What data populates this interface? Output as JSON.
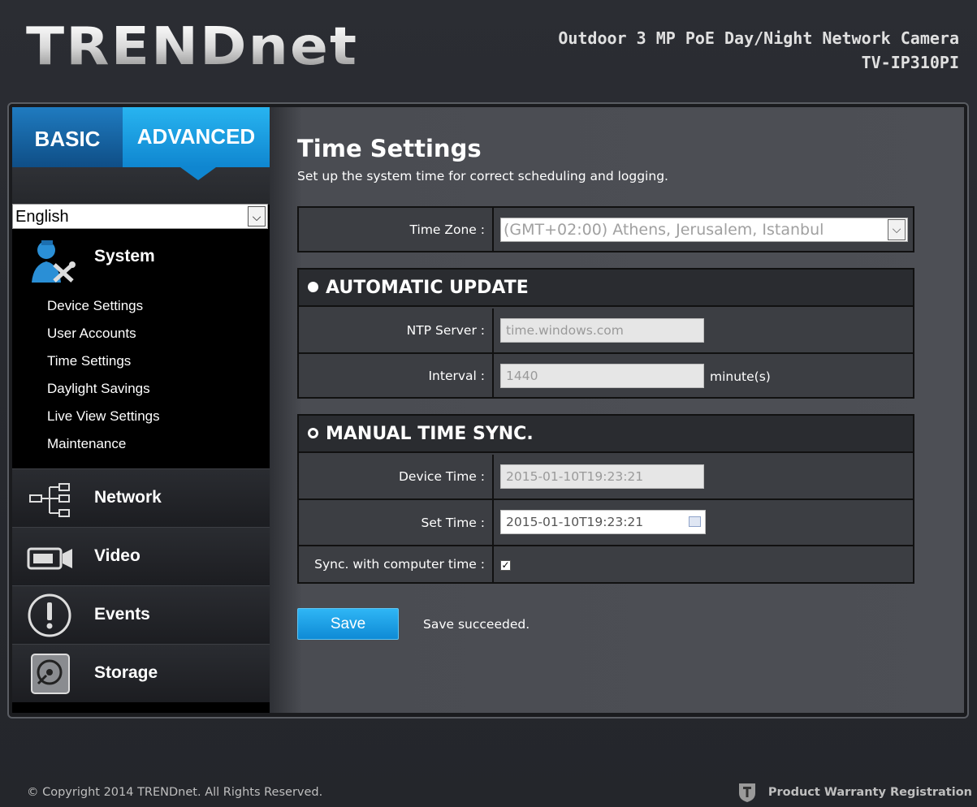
{
  "header": {
    "logo_text": "TRENDnet",
    "product_line": "Outdoor 3 MP PoE Day/Night Network Camera",
    "model": "TV-IP310PI"
  },
  "tabs": {
    "basic": "BASIC",
    "advanced": "ADVANCED",
    "active": "ADVANCED"
  },
  "language": {
    "selected": "English"
  },
  "sidebar": {
    "system": {
      "label": "System",
      "icon": "user-tools-icon",
      "items": [
        {
          "label": "Device Settings"
        },
        {
          "label": "User Accounts"
        },
        {
          "label": "Time Settings"
        },
        {
          "label": "Daylight Savings"
        },
        {
          "label": "Live View Settings"
        },
        {
          "label": "Maintenance"
        }
      ]
    },
    "sections": [
      {
        "label": "Network",
        "icon": "network-tree-icon"
      },
      {
        "label": "Video",
        "icon": "camera-icon"
      },
      {
        "label": "Events",
        "icon": "alert-icon"
      },
      {
        "label": "Storage",
        "icon": "disk-icon"
      }
    ]
  },
  "page": {
    "title": "Time Settings",
    "subtitle": "Set up the system time for correct scheduling and logging."
  },
  "timezone": {
    "label": "Time Zone :",
    "value": "(GMT+02:00) Athens, Jerusalem, Istanbul"
  },
  "automatic": {
    "heading": "AUTOMATIC UPDATE",
    "ntp_label": "NTP Server :",
    "ntp_value": "time.windows.com",
    "interval_label": "Interval :",
    "interval_value": "1440",
    "interval_unit": "minute(s)"
  },
  "manual": {
    "heading": "MANUAL TIME SYNC.",
    "device_time_label": "Device Time :",
    "device_time_value": "2015-01-10T19:23:21",
    "set_time_label": "Set Time :",
    "set_time_value": "2015-01-10T19:23:21",
    "sync_label": "Sync. with computer time :",
    "sync_checked": true
  },
  "actions": {
    "save_label": "Save",
    "status": "Save succeeded."
  },
  "footer": {
    "copyright": "© Copyright 2014 TRENDnet. All Rights Reserved.",
    "warranty": "Product Warranty Registration"
  },
  "colors": {
    "accent": "#1a9be3",
    "background": "#26282e",
    "content": "#4d4f55"
  }
}
